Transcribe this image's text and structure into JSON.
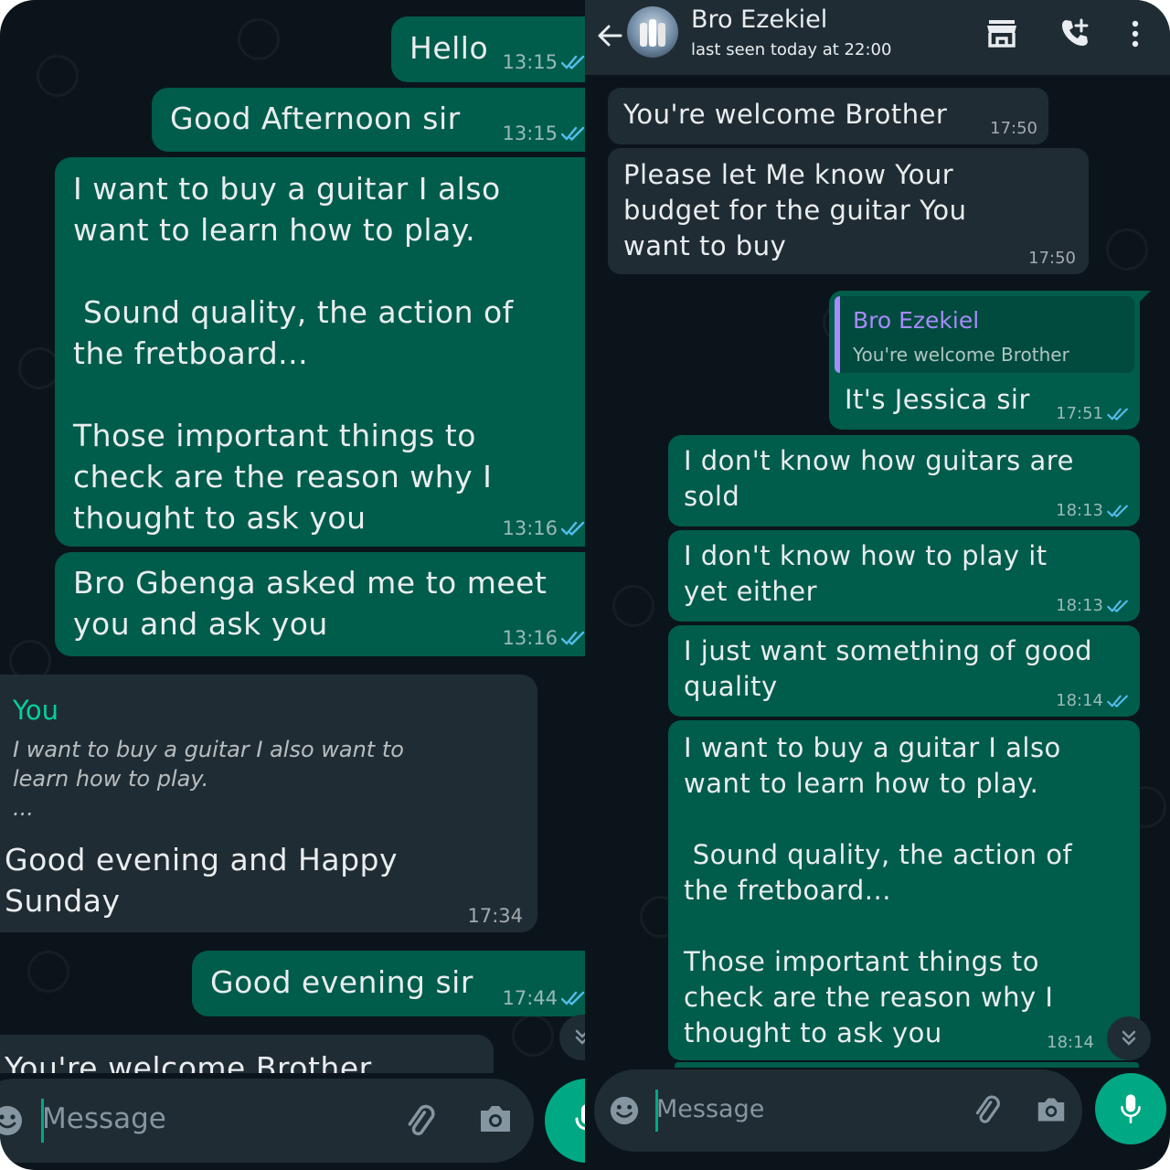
{
  "left": {
    "messages": [
      {
        "text": "Hello",
        "time": "13:15"
      },
      {
        "text": "Good Afternoon sir",
        "time": "13:15"
      },
      {
        "text": "I want to buy a guitar I also\nwant to learn how to play.\n\n Sound quality, the action of\nthe fretboard...\n\nThose important things to\ncheck are the reason why I\nthought to ask you",
        "time": "13:16"
      },
      {
        "text": "Bro Gbenga asked me to meet\nyou and ask you",
        "time": "13:16"
      },
      {
        "quote_author": "You",
        "quote_text": "I want to buy a guitar I also want to\nlearn how to play.\n...",
        "text": "Good evening and Happy\nSunday",
        "time": "17:34"
      },
      {
        "text": "Good evening sir",
        "time": "17:44"
      },
      {
        "text": "You're welcome Brother"
      }
    ],
    "composer": {
      "placeholder": "Message"
    }
  },
  "right": {
    "header": {
      "name": "Bro Ezekiel",
      "status": "last seen today at 22:00"
    },
    "messages": [
      {
        "text": "You're welcome Brother",
        "time": "17:50"
      },
      {
        "text": "Please let Me know Your\nbudget for the guitar You\nwant to buy",
        "time": "17:50"
      },
      {
        "quote_author": "Bro Ezekiel",
        "quote_text": "You're welcome Brother",
        "text": "It's Jessica sir",
        "time": "17:51"
      },
      {
        "text": "I don't know how guitars are\nsold",
        "time": "18:13"
      },
      {
        "text": "I don't know how to play it\nyet either",
        "time": "18:13"
      },
      {
        "text": "I just want something of good\nquality",
        "time": "18:14"
      },
      {
        "text": "I want to buy a guitar I also\nwant to learn how to play.\n\n Sound quality, the action of\nthe fretboard...\n\nThose important things to\ncheck are the reason why I\nthought to ask you",
        "time": "18:14"
      }
    ],
    "composer": {
      "placeholder": "Message"
    }
  },
  "colors": {
    "background": "#0b141a",
    "outgoing_bubble": "#005c4b",
    "incoming_bubble": "#202c33",
    "read_ticks": "#53bdeb",
    "accent": "#00a884",
    "you_quote_author": "#06cf9c",
    "contact_quote_author": "#a78bfa"
  },
  "icons": [
    "back-arrow-icon",
    "avatar",
    "shop-icon",
    "add-call-icon",
    "more-vert-icon",
    "emoji-icon",
    "attach-icon",
    "camera-icon",
    "mic-icon",
    "double-check-icon",
    "chevron-double-down-icon"
  ]
}
